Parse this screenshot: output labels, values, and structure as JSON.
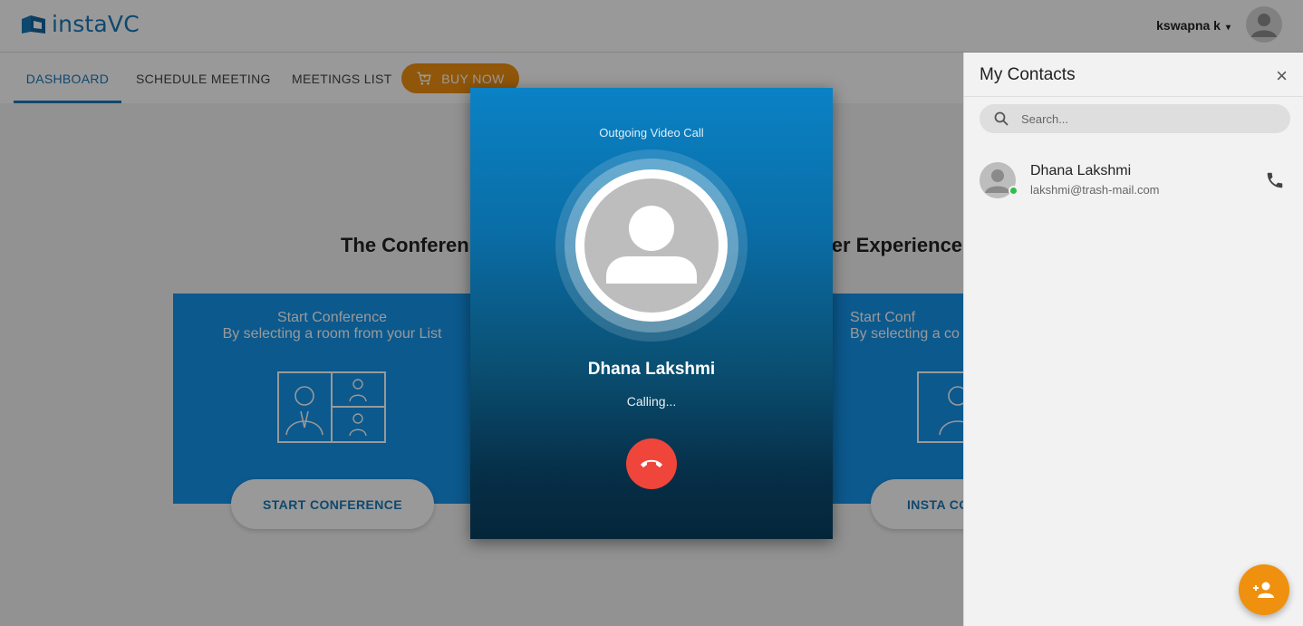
{
  "app": {
    "logo_text": "instaVC",
    "brand_color": "#1a78b8",
    "accent_color": "#f0900f"
  },
  "header": {
    "user_name": "kswapna k",
    "user_caret": "▾"
  },
  "tabs": [
    {
      "label": "DASHBOARD",
      "active": true
    },
    {
      "label": "SCHEDULE MEETING",
      "active": false
    },
    {
      "label": "MEETINGS LIST",
      "active": false
    }
  ],
  "buy_now": {
    "label": "BUY NOW",
    "icon": "cart-icon"
  },
  "main": {
    "title_left": "The Conferen",
    "title_right": "er Experience",
    "cards": [
      {
        "line1": "Start Conference",
        "line2": "By selecting a room from your List",
        "button": "START CONFERENCE"
      },
      {
        "line1": "Start Conf",
        "line2": "By selecting a co",
        "button": "INSTA CO"
      }
    ]
  },
  "contacts": {
    "title": "My Contacts",
    "close_icon": "×",
    "search_placeholder": "Search...",
    "items": [
      {
        "name": "Dhana Lakshmi",
        "email": "lakshmi@trash-mail.com",
        "status": "online",
        "status_color": "#2fbd4c"
      }
    ]
  },
  "call": {
    "type": "Outgoing Video Call",
    "callee": "Dhana Lakshmi",
    "status": "Calling...",
    "hangup_color": "#f0453a"
  }
}
